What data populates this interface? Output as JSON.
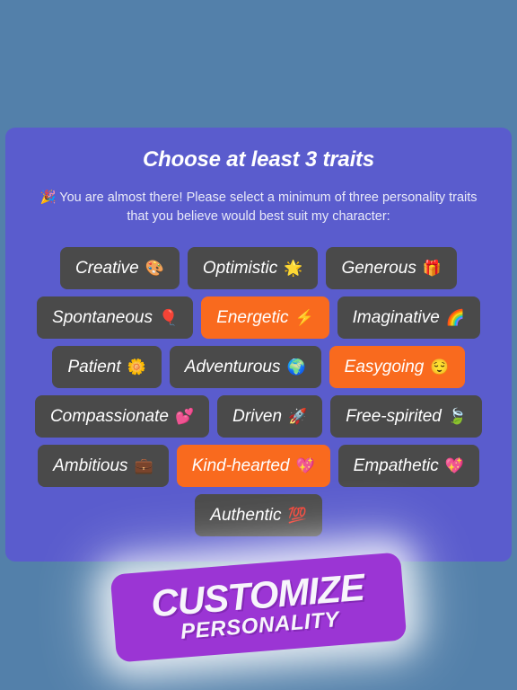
{
  "background": {
    "color": "#5380aa"
  },
  "card": {
    "background_color": "#5a5ccd",
    "title": "Choose at least 3 traits",
    "subtitle": "🎉 You are almost there! Please select a minimum of three personality traits that you believe would best suit my character:",
    "chip_color": "#4a4a4a",
    "chip_selected_color": "#f96a1e",
    "traits": [
      {
        "label": "Creative",
        "emoji": "🎨",
        "emoji_name": "artist-palette-icon",
        "selected": false
      },
      {
        "label": "Optimistic",
        "emoji": "🌟",
        "emoji_name": "glowing-star-icon",
        "selected": false
      },
      {
        "label": "Generous",
        "emoji": "🎁",
        "emoji_name": "gift-icon",
        "selected": false
      },
      {
        "label": "Spontaneous",
        "emoji": "🎈",
        "emoji_name": "balloon-icon",
        "selected": false
      },
      {
        "label": "Energetic",
        "emoji": "⚡",
        "emoji_name": "lightning-bolt-icon",
        "selected": true
      },
      {
        "label": "Imaginative",
        "emoji": "🌈",
        "emoji_name": "rainbow-icon",
        "selected": false
      },
      {
        "label": "Patient",
        "emoji": "🌼",
        "emoji_name": "blossom-flower-icon",
        "selected": false
      },
      {
        "label": "Adventurous",
        "emoji": "🌍",
        "emoji_name": "globe-icon",
        "selected": false
      },
      {
        "label": "Easygoing",
        "emoji": "😌",
        "emoji_name": "relieved-face-icon",
        "selected": true
      },
      {
        "label": "Compassionate",
        "emoji": "💕",
        "emoji_name": "two-hearts-icon",
        "selected": false
      },
      {
        "label": "Driven",
        "emoji": "🚀",
        "emoji_name": "rocket-icon",
        "selected": false
      },
      {
        "label": "Free-spirited",
        "emoji": "🍃",
        "emoji_name": "leaf-fluttering-icon",
        "selected": false
      },
      {
        "label": "Ambitious",
        "emoji": "💼",
        "emoji_name": "briefcase-icon",
        "selected": false
      },
      {
        "label": "Kind-hearted",
        "emoji": "💖",
        "emoji_name": "sparkling-heart-icon",
        "selected": true
      },
      {
        "label": "Empathetic",
        "emoji": "💖",
        "emoji_name": "sparkling-heart-icon",
        "selected": false
      },
      {
        "label": "Authentic",
        "emoji": "💯",
        "emoji_name": "hundred-points-icon",
        "selected": false
      }
    ]
  },
  "banner": {
    "title": "CUSTOMIZE",
    "subtitle": "PERSONALITY",
    "color": "#9b35d4"
  }
}
